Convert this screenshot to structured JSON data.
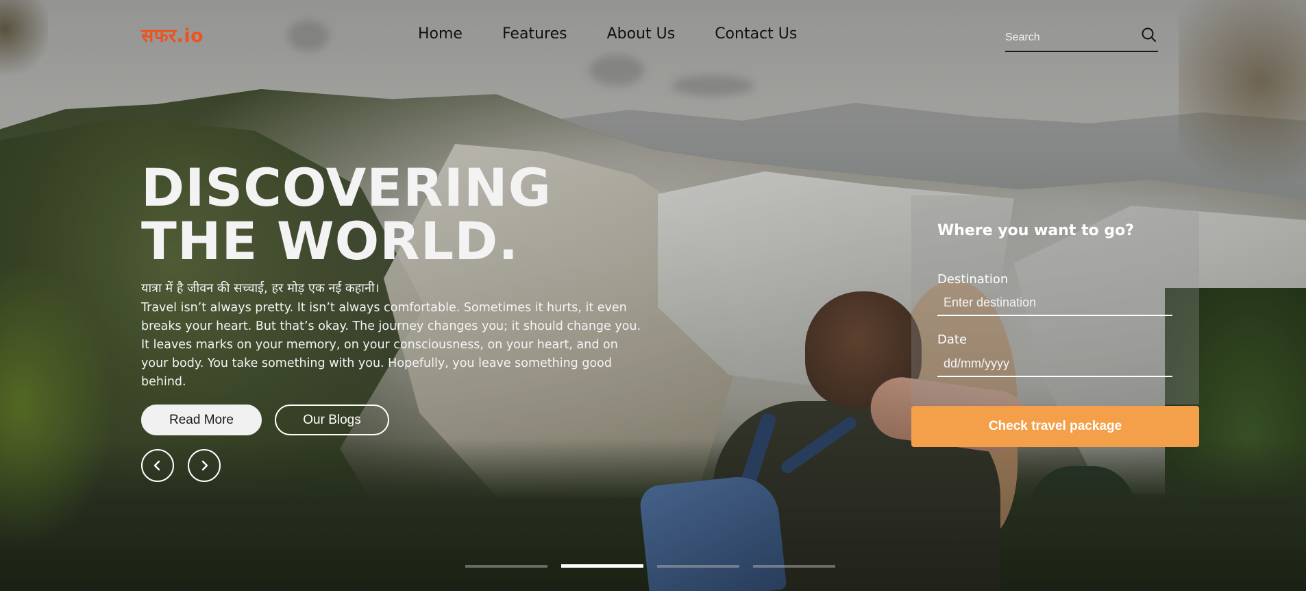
{
  "brand": {
    "logo_text": "सफर.io",
    "logo_color": "#f0521e"
  },
  "nav": {
    "items": [
      {
        "label": "Home"
      },
      {
        "label": "Features"
      },
      {
        "label": "About Us"
      },
      {
        "label": "Contact Us"
      }
    ]
  },
  "search": {
    "placeholder": "Search",
    "icon": "search-icon"
  },
  "hero": {
    "title_line1": "DISCOVERING",
    "title_line2": "THE WORLD.",
    "subtitle_hindi": "यात्रा में है जीवन की सच्चाई, हर मोड़ एक नई कहानी।",
    "body": "Travel isn’t always pretty. It isn’t always comfortable. Sometimes it hurts, it even breaks your heart. But that’s okay. The journey changes you; it should change you. It leaves marks on your memory, on your consciousness, on your heart, and on your body. You take something with you. Hopefully, you leave something good behind.",
    "read_more_label": "Read More",
    "blogs_label": "Our Blogs",
    "prev_icon": "chevron-left-icon",
    "next_icon": "chevron-right-icon"
  },
  "booking": {
    "title": "Where you want to go?",
    "destination_label": "Destination",
    "destination_placeholder": "Enter destination",
    "date_label": "Date",
    "date_placeholder": "dd/mm/yyyy",
    "submit_label": "Check travel package",
    "accent_color": "#f4a04a"
  },
  "slider": {
    "count": 4,
    "active_index": 1
  }
}
